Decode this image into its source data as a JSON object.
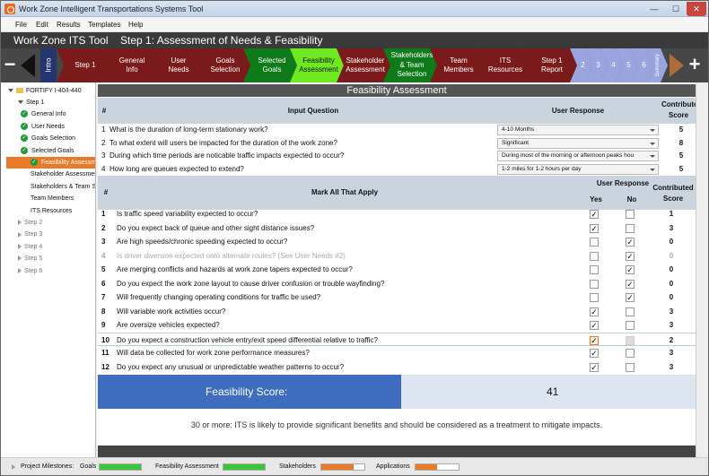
{
  "window": {
    "title": "Work Zone Intelligent Transportations Systems Tool",
    "min": "—",
    "max": "☐",
    "close": "✕"
  },
  "menu": [
    "File",
    "Edit",
    "Results",
    "Templates",
    "Help"
  ],
  "header": {
    "app_name": "Work Zone ITS Tool",
    "step_title": "Step 1: Assessment of Needs & Feasibility"
  },
  "nav": {
    "minus": "−",
    "plus": "+",
    "intro": "Intro",
    "summary": "Summary",
    "steps": [
      {
        "label": "Step 1",
        "state": "maroon"
      },
      {
        "label": "General Info",
        "state": "maroon"
      },
      {
        "label": "User Needs",
        "state": "maroon"
      },
      {
        "label": "Goals Selection",
        "state": "maroon"
      },
      {
        "label": "Selected Goals",
        "state": "green"
      },
      {
        "label": "Feasibility Assessment",
        "state": "lime"
      },
      {
        "label": "Stakeholder Assessment",
        "state": "maroon"
      },
      {
        "label": "Stakeholders & Team Selection",
        "state": "green"
      },
      {
        "label": "Team Members",
        "state": "maroon"
      },
      {
        "label": "ITS Resources",
        "state": "maroon"
      },
      {
        "label": "Step 1 Report",
        "state": "maroon"
      },
      {
        "label": "2",
        "state": "lav"
      },
      {
        "label": "3",
        "state": "lav"
      },
      {
        "label": "4",
        "state": "lav"
      },
      {
        "label": "5",
        "state": "lav"
      },
      {
        "label": "6",
        "state": "lav"
      }
    ]
  },
  "sidebar": {
    "root": "FORTIFY I-40/I-440",
    "items": [
      {
        "label": "Step 1",
        "type": "expanded"
      },
      {
        "label": "General Info",
        "type": "check"
      },
      {
        "label": "User Needs",
        "type": "check"
      },
      {
        "label": "Goals Selection",
        "type": "check"
      },
      {
        "label": "Selected Goals",
        "type": "check"
      },
      {
        "label": "Feasibility Assessment",
        "type": "selected"
      },
      {
        "label": "Stakeholder Assessment",
        "type": "plain"
      },
      {
        "label": "Stakeholders & Team Selection",
        "type": "plain"
      },
      {
        "label": "Team Members",
        "type": "plain"
      },
      {
        "label": "ITS Resources",
        "type": "plain"
      },
      {
        "label": "Step 2",
        "type": "collapsed"
      },
      {
        "label": "Step 3",
        "type": "collapsed"
      },
      {
        "label": "Step 4",
        "type": "collapsed"
      },
      {
        "label": "Step 5",
        "type": "collapsed"
      },
      {
        "label": "Step 6",
        "type": "collapsed"
      }
    ]
  },
  "panel": {
    "title": "Feasibility Assessment"
  },
  "questions_table": {
    "headers": {
      "num": "#",
      "question": "Input Question",
      "response": "User Response",
      "score": "Contributed Score"
    },
    "rows": [
      {
        "num": "1",
        "question": "What is the duration of long-term stationary work?",
        "response": "4-10 Months",
        "score": "5"
      },
      {
        "num": "2",
        "question": "To what extent will users be impacted for the duration of the work zone?",
        "response": "Significant",
        "score": "8"
      },
      {
        "num": "3",
        "question": "During which time periods are noticable traffic impacts expected to occur?",
        "response": "During most of the morning or afternoon peaks hou",
        "score": "5"
      },
      {
        "num": "4",
        "question": "How long are queues expected to extend?",
        "response": "1-2 miles for 1-2 hours per day",
        "score": "5"
      }
    ]
  },
  "mark_table": {
    "headers": {
      "num": "#",
      "question": "Mark All That Apply",
      "response": "User Response",
      "yes": "Yes",
      "no": "No",
      "score": "Contributed Score"
    },
    "rows": [
      {
        "num": "1",
        "question": "Is traffic speed variability expected to occur?",
        "yes": "✓",
        "no": "",
        "score": "1",
        "state": "normal"
      },
      {
        "num": "2",
        "question": "Do you expect back of queue and other sight distance issues?",
        "yes": "✓",
        "no": "",
        "score": "3",
        "state": "normal"
      },
      {
        "num": "3",
        "question": "Are high speeds/chronic speeding expected to occur?",
        "yes": "",
        "no": "✓",
        "score": "0",
        "state": "normal"
      },
      {
        "num": "4",
        "question": "Is driver diversion expected onto alternate routes? (See User Needs #2)",
        "yes": "",
        "no": "✓",
        "score": "0",
        "state": "disabled"
      },
      {
        "num": "5",
        "question": "Are merging conflicts and hazards at work zone tapers expected to occur?",
        "yes": "",
        "no": "✓",
        "score": "0",
        "state": "normal"
      },
      {
        "num": "6",
        "question": "Do you expect the work zone layout to cause driver confusion or trouble wayfinding?",
        "yes": "",
        "no": "✓",
        "score": "0",
        "state": "normal"
      },
      {
        "num": "7",
        "question": "Will frequently changing operating conditions for traffic be used?",
        "yes": "",
        "no": "✓",
        "score": "0",
        "state": "normal"
      },
      {
        "num": "8",
        "question": "Will variable work activities occur?",
        "yes": "✓",
        "no": "",
        "score": "3",
        "state": "normal"
      },
      {
        "num": "9",
        "question": "Are oversize vehicles expected?",
        "yes": "✓",
        "no": "",
        "score": "3",
        "state": "normal"
      },
      {
        "num": "10",
        "question": "Do you expect a construction vehicle entry/exit speed differential relative to traffic?",
        "yes": "✓",
        "no": "",
        "score": "2",
        "state": "highlight"
      },
      {
        "num": "11",
        "question": "Will data be collected for work zone performance measures?",
        "yes": "✓",
        "no": "",
        "score": "3",
        "state": "normal"
      },
      {
        "num": "12",
        "question": "Do you expect any unusual or unpredictable weather patterns to occur?",
        "yes": "✓",
        "no": "",
        "score": "3",
        "state": "normal"
      }
    ]
  },
  "score": {
    "label": "Feasibility Score:",
    "value": "41",
    "note": "30 or more: ITS is likely to provide significant benefits and should be considered as a treatment to mitigate impacts."
  },
  "milestones": {
    "label": "Project Milestones:",
    "items": [
      {
        "label": "Goals",
        "fill": 1.0,
        "color": "#3cc43c"
      },
      {
        "label": "Feasibility Assessment",
        "fill": 1.0,
        "color": "#3cc43c"
      },
      {
        "label": "Stakeholders",
        "fill": 0.75,
        "color": "#e97a2a"
      },
      {
        "label": "Applications",
        "fill": 0.5,
        "color": "#e97a2a"
      }
    ]
  }
}
